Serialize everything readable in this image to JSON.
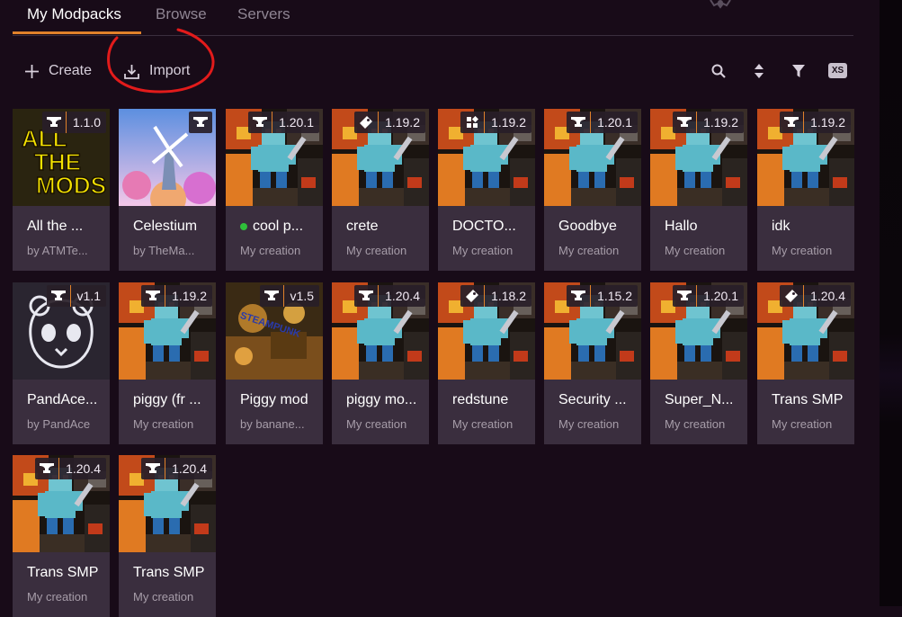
{
  "tabs": [
    {
      "label": "My Modpacks",
      "active": true
    },
    {
      "label": "Browse"
    },
    {
      "label": "Servers"
    }
  ],
  "toolbar": {
    "create_label": "Create",
    "import_label": "Import",
    "size_badge": "XS"
  },
  "colors": {
    "accent": "#e0812a",
    "background": "#180b18",
    "card": "#3a2e3e",
    "annotation": "#e21b1b"
  },
  "modpacks": [
    {
      "name": "All the ...",
      "sub": "by ATMTe...",
      "version": "1.1.0",
      "loader": "anvil-icon",
      "thumb": "atm"
    },
    {
      "name": "Celestium",
      "sub": "by TheMa...",
      "version": "",
      "loader": "anvil-icon",
      "thumb": "celestium"
    },
    {
      "name": "cool p...",
      "sub": "My creation",
      "version": "1.20.1",
      "loader": "anvil-icon",
      "thumb": "default",
      "running": true
    },
    {
      "name": "crete",
      "sub": "My creation",
      "version": "1.19.2",
      "loader": "tag-icon",
      "thumb": "default"
    },
    {
      "name": "DOCTO...",
      "sub": "My creation",
      "version": "1.19.2",
      "loader": "grid-icon",
      "thumb": "default"
    },
    {
      "name": "Goodbye",
      "sub": "My creation",
      "version": "1.20.1",
      "loader": "anvil-icon",
      "thumb": "default"
    },
    {
      "name": "Hallo",
      "sub": "My creation",
      "version": "1.19.2",
      "loader": "anvil-icon",
      "thumb": "default"
    },
    {
      "name": "idk",
      "sub": "My creation",
      "version": "1.19.2",
      "loader": "anvil-icon",
      "thumb": "default"
    },
    {
      "name": "PandAce...",
      "sub": "by PandAce",
      "version": "v1.1",
      "loader": "anvil-icon",
      "thumb": "panda"
    },
    {
      "name": "piggy (fr ...",
      "sub": "My creation",
      "version": "1.19.2",
      "loader": "anvil-icon",
      "thumb": "default"
    },
    {
      "name": "Piggy mod",
      "sub": "by banane...",
      "version": "v1.5",
      "loader": "anvil-icon",
      "thumb": "steampunk",
      "thumb_text": "STEAMPUNK"
    },
    {
      "name": "piggy mo...",
      "sub": "My creation",
      "version": "1.20.4",
      "loader": "anvil-icon",
      "thumb": "default"
    },
    {
      "name": "redstune",
      "sub": "My creation",
      "version": "1.18.2",
      "loader": "tag-icon",
      "thumb": "default"
    },
    {
      "name": "Security ...",
      "sub": "My creation",
      "version": "1.15.2",
      "loader": "anvil-icon",
      "thumb": "default"
    },
    {
      "name": "Super_N...",
      "sub": "My creation",
      "version": "1.20.1",
      "loader": "anvil-icon",
      "thumb": "default"
    },
    {
      "name": "Trans SMP",
      "sub": "My creation",
      "version": "1.20.4",
      "loader": "tag-icon",
      "thumb": "default"
    },
    {
      "name": "Trans SMP",
      "sub": "My creation",
      "version": "1.20.4",
      "loader": "anvil-icon",
      "thumb": "default"
    },
    {
      "name": "Trans SMP",
      "sub": "My creation",
      "version": "1.20.4",
      "loader": "anvil-icon",
      "thumb": "default"
    }
  ]
}
